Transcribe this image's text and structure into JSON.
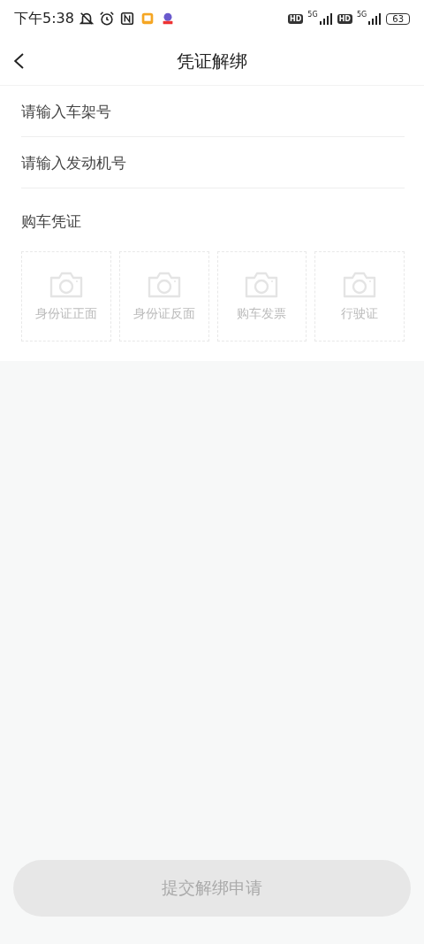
{
  "status_bar": {
    "time": "下午5:38",
    "sims": [
      {
        "hd": "HD",
        "network": "5G"
      },
      {
        "hd": "HD",
        "network": "5G"
      }
    ],
    "battery": "63"
  },
  "header": {
    "title": "凭证解绑"
  },
  "fields": [
    {
      "placeholder": "请输入车架号"
    },
    {
      "placeholder": "请输入发动机号"
    }
  ],
  "section": {
    "title": "购车凭证"
  },
  "uploads": [
    {
      "label": "身份证正面"
    },
    {
      "label": "身份证反面"
    },
    {
      "label": "购车发票"
    },
    {
      "label": "行驶证"
    }
  ],
  "submit_button": {
    "label": "提交解绑申请",
    "disabled": true
  }
}
